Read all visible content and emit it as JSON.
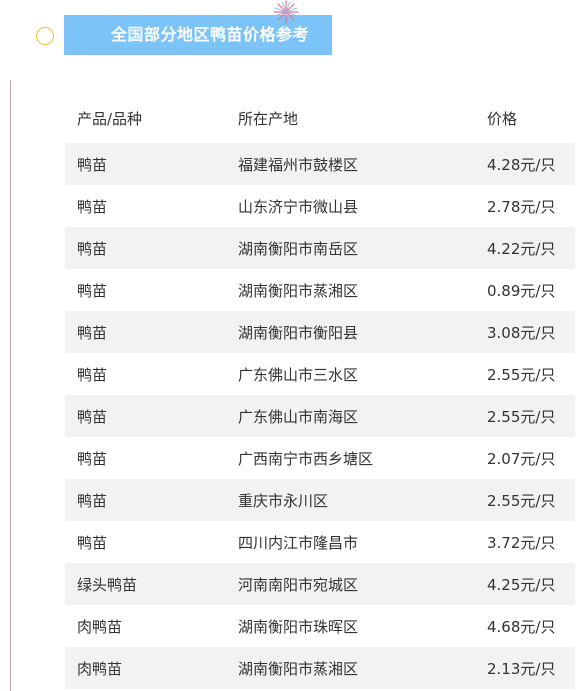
{
  "title": "全国部分地区鸭苗价格参考",
  "table": {
    "headers": [
      "产品/品种",
      "所在产地",
      "价格"
    ],
    "rows": [
      [
        "鸭苗",
        "福建福州市鼓楼区",
        "4.28元/只"
      ],
      [
        "鸭苗",
        "山东济宁市微山县",
        "2.78元/只"
      ],
      [
        "鸭苗",
        "湖南衡阳市南岳区",
        "4.22元/只"
      ],
      [
        "鸭苗",
        "湖南衡阳市蒸湘区",
        "0.89元/只"
      ],
      [
        "鸭苗",
        "湖南衡阳市衡阳县",
        "3.08元/只"
      ],
      [
        "鸭苗",
        "广东佛山市三水区",
        "2.55元/只"
      ],
      [
        "鸭苗",
        "广东佛山市南海区",
        "2.55元/只"
      ],
      [
        "鸭苗",
        "广西南宁市西乡塘区",
        "2.07元/只"
      ],
      [
        "鸭苗",
        "重庆市永川区",
        "2.55元/只"
      ],
      [
        "鸭苗",
        "四川内江市隆昌市",
        "3.72元/只"
      ],
      [
        "绿头鸭苗",
        "河南南阳市宛城区",
        "4.25元/只"
      ],
      [
        "肉鸭苗",
        "湖南衡阳市珠晖区",
        "4.68元/只"
      ],
      [
        "肉鸭苗",
        "湖南衡阳市蒸湘区",
        "2.13元/只"
      ]
    ]
  },
  "colors": {
    "banner": "#7cc4f7",
    "row_shade": "#f2f2f2",
    "circle": "#f2c230",
    "side_line": "#c9a2a2",
    "firework": "#e8738a"
  },
  "icons": {
    "circle": "circle-decoration-icon",
    "firework": "firework-icon"
  }
}
